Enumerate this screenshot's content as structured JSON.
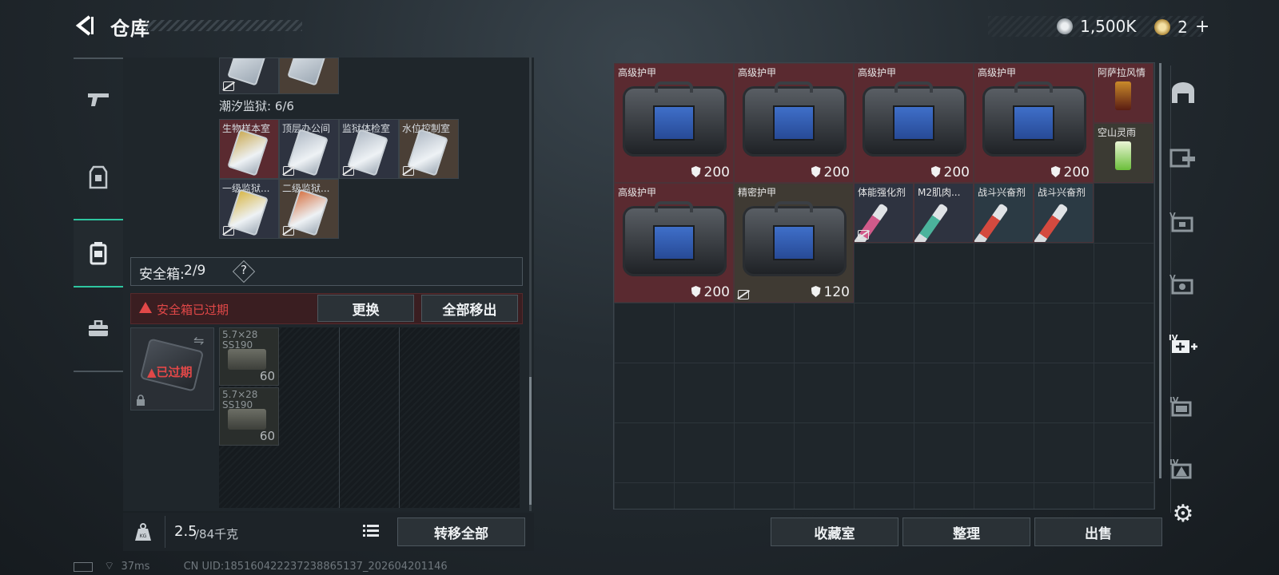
{
  "header": {
    "title": "仓库",
    "silver_amount": "1,500K",
    "gold_amount": "2",
    "gold_plus": "+"
  },
  "left_nav": {
    "items": [
      {
        "name": "weapon"
      },
      {
        "name": "armor-vest"
      },
      {
        "name": "storage-box"
      },
      {
        "name": "toolbox"
      }
    ],
    "active": "storage-box"
  },
  "left_panel": {
    "top_cells_count": 2,
    "prison_group": {
      "label": "潮汐监狱: 6/6",
      "cards": [
        {
          "label": "生物样本室",
          "color": "#c8a64a"
        },
        {
          "label": "顶层办公间",
          "color": "#aeb8c4"
        },
        {
          "label": "监狱体检室",
          "color": "#aeb8c4"
        },
        {
          "label": "水位控制室",
          "color": "#aeb8c4"
        },
        {
          "label": "一级监狱...",
          "color": "#d6b23c"
        },
        {
          "label": "二级监狱...",
          "color": "#d46b3a"
        }
      ]
    },
    "safebox": {
      "label": "安全箱:",
      "count": "2/9",
      "help": "?"
    },
    "expired": {
      "text": "安全箱已过期",
      "replace_btn": "更换",
      "remove_all_btn": "全部移出",
      "box_badge": "已过期"
    },
    "ammo": [
      {
        "label": "5.7×28\nSS190",
        "count": "60"
      },
      {
        "label": "5.7×28\nSS190",
        "count": "60"
      }
    ],
    "weight": {
      "current": "2.5",
      "max": "/84千克"
    },
    "transfer_all": "转移全部"
  },
  "right_panel": {
    "items": [
      {
        "label": "高级护甲",
        "dur": "200",
        "kind": "bag",
        "bg": "#5a2a30"
      },
      {
        "label": "高级护甲",
        "dur": "200",
        "kind": "bag",
        "bg": "#5a2a30"
      },
      {
        "label": "高级护甲",
        "dur": "200",
        "kind": "bag",
        "bg": "#5a2a30"
      },
      {
        "label": "高级护甲",
        "dur": "200",
        "kind": "bag",
        "bg": "#5a2a30"
      },
      {
        "label": "阿萨拉风情",
        "kind": "drink",
        "bg": "#5a2a30"
      },
      {
        "label": "空山灵雨",
        "kind": "drink2",
        "bg": "#3b3a33"
      },
      {
        "label": "高级护甲",
        "dur": "200",
        "kind": "bag",
        "bg": "#5a2a30"
      },
      {
        "label": "精密护甲",
        "dur": "120",
        "kind": "bag",
        "bg": "#3f3a33"
      },
      {
        "label": "体能强化剂",
        "kind": "syringe",
        "bg": "#2e3340",
        "color": "#d15a8a"
      },
      {
        "label": "M2肌肉...",
        "kind": "syringe",
        "bg": "#2e3340",
        "color": "#4bb39c"
      },
      {
        "label": "战斗兴奋剂",
        "kind": "syringe",
        "bg": "#2b3a44",
        "color": "#d44a3f"
      },
      {
        "label": "战斗兴奋剂",
        "kind": "syringe",
        "bg": "#2b3a44",
        "color": "#d44a3f"
      }
    ],
    "buttons": {
      "collection": "收藏室",
      "organize": "整理",
      "sell": "出售"
    }
  },
  "right_nav": {
    "items": [
      "garage",
      "gun-chest",
      "level5-chest",
      "level5-chest-b",
      "level4-add",
      "level4-chest",
      "level4-case"
    ]
  },
  "status": {
    "ping": "37ms",
    "uid": "CN UID:185160422237238865137_202604201146"
  }
}
